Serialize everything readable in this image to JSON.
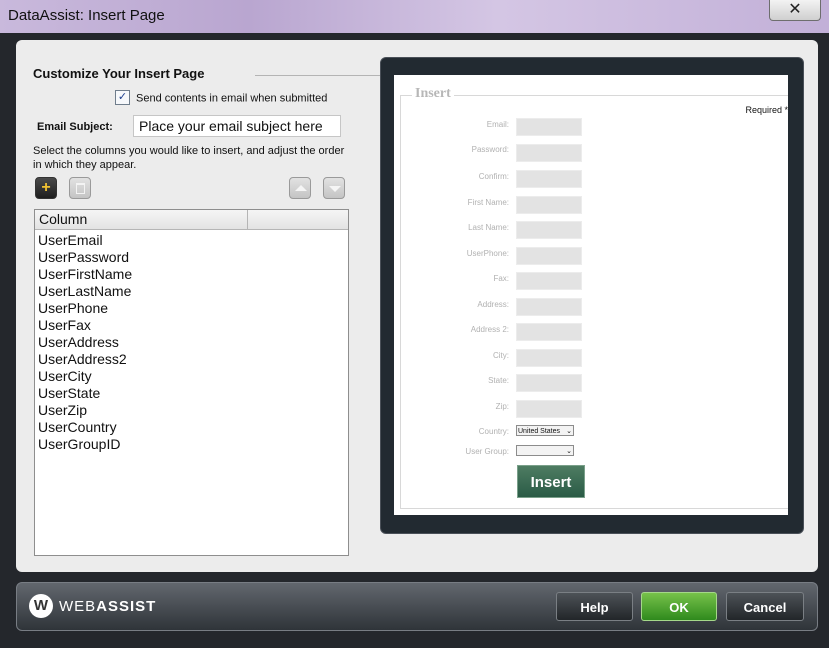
{
  "window": {
    "title": "DataAssist: Insert Page",
    "close_glyph": "✕"
  },
  "left_panel": {
    "heading": "Customize Your Insert Page",
    "email_checkbox": {
      "label": "Send contents in email when submitted",
      "checked": true,
      "glyph": "✓"
    },
    "email_subject": {
      "label": "Email Subject:",
      "value": "Place your email subject here"
    },
    "instructions": "Select the columns you would like to insert, and adjust the order in which they appear.",
    "add_glyph": "+",
    "column_list": {
      "header": "Column",
      "items": [
        "UserEmail",
        "UserPassword",
        "UserFirstName",
        "UserLastName",
        "UserPhone",
        "UserFax",
        "UserAddress",
        "UserAddress2",
        "UserCity",
        "UserState",
        "UserZip",
        "UserCountry",
        "UserGroupID"
      ]
    }
  },
  "preview": {
    "legend": "Insert",
    "required_note": "Required *",
    "fields": [
      "Email:",
      "Password:",
      "Confirm:",
      "First Name:",
      "Last Name:",
      "UserPhone:",
      "Fax:",
      "Address:",
      "Address 2:",
      "City:",
      "State:",
      "Zip:"
    ],
    "country_label": "Country:",
    "country_value": "United States",
    "usergroup_label": "User Group:",
    "usergroup_value": "",
    "select_arrow": "⌄",
    "insert_button": "Insert"
  },
  "footer": {
    "logo_mark": "W",
    "logo_text_light": "WEB",
    "logo_text_bold": "ASSIST",
    "help": "Help",
    "ok": "OK",
    "cancel": "Cancel"
  }
}
